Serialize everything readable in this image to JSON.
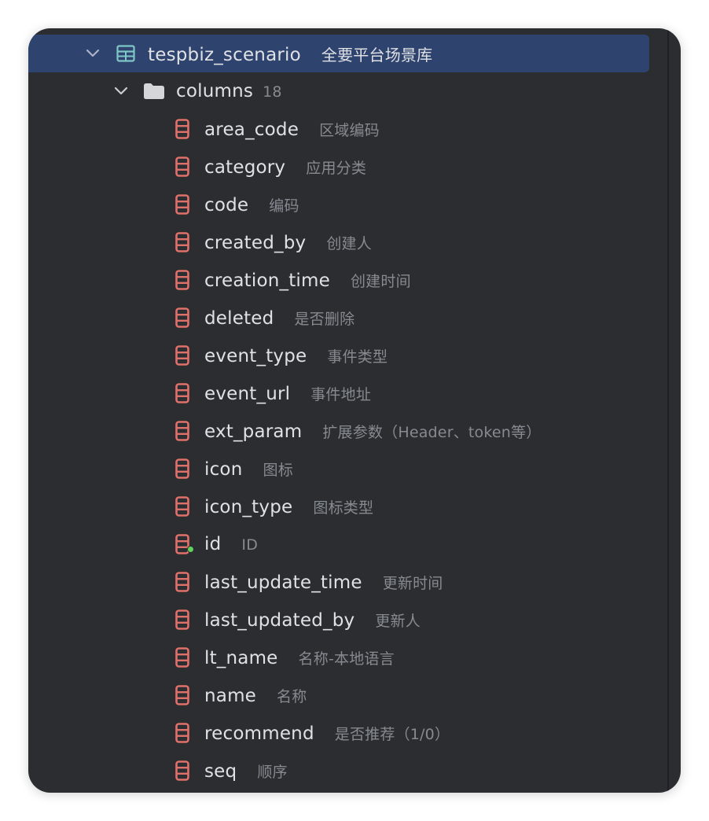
{
  "table": {
    "name": "tespbiz_scenario",
    "comment": "全要平台场景库",
    "icon": "table-icon",
    "expanded": true
  },
  "columns_folder": {
    "label": "columns",
    "count": "18",
    "icon": "folder-icon",
    "expanded": true
  },
  "columns": [
    {
      "name": "area_code",
      "comment": "区域编码"
    },
    {
      "name": "category",
      "comment": "应用分类"
    },
    {
      "name": "code",
      "comment": "编码"
    },
    {
      "name": "created_by",
      "comment": "创建人"
    },
    {
      "name": "creation_time",
      "comment": "创建时间"
    },
    {
      "name": "deleted",
      "comment": "是否删除"
    },
    {
      "name": "event_type",
      "comment": "事件类型"
    },
    {
      "name": "event_url",
      "comment": "事件地址"
    },
    {
      "name": "ext_param",
      "comment": "扩展参数（Header、token等）"
    },
    {
      "name": "icon",
      "comment": "图标"
    },
    {
      "name": "icon_type",
      "comment": "图标类型"
    },
    {
      "name": "id",
      "comment": "ID"
    },
    {
      "name": "last_update_time",
      "comment": "更新时间"
    },
    {
      "name": "last_updated_by",
      "comment": "更新人"
    },
    {
      "name": "lt_name",
      "comment": "名称-本地语言"
    },
    {
      "name": "name",
      "comment": "名称"
    },
    {
      "name": "recommend",
      "comment": "是否推荐（1/0）"
    },
    {
      "name": "seq",
      "comment": "顺序"
    }
  ],
  "colors": {
    "background": "#2b2d30",
    "selection": "#2e436e",
    "text": "#dfe1e5",
    "muted_text": "#868a91",
    "column_icon": "#e0706a",
    "table_icon": "#7fc6c6",
    "primary_key_dot": "#5fd35b"
  }
}
